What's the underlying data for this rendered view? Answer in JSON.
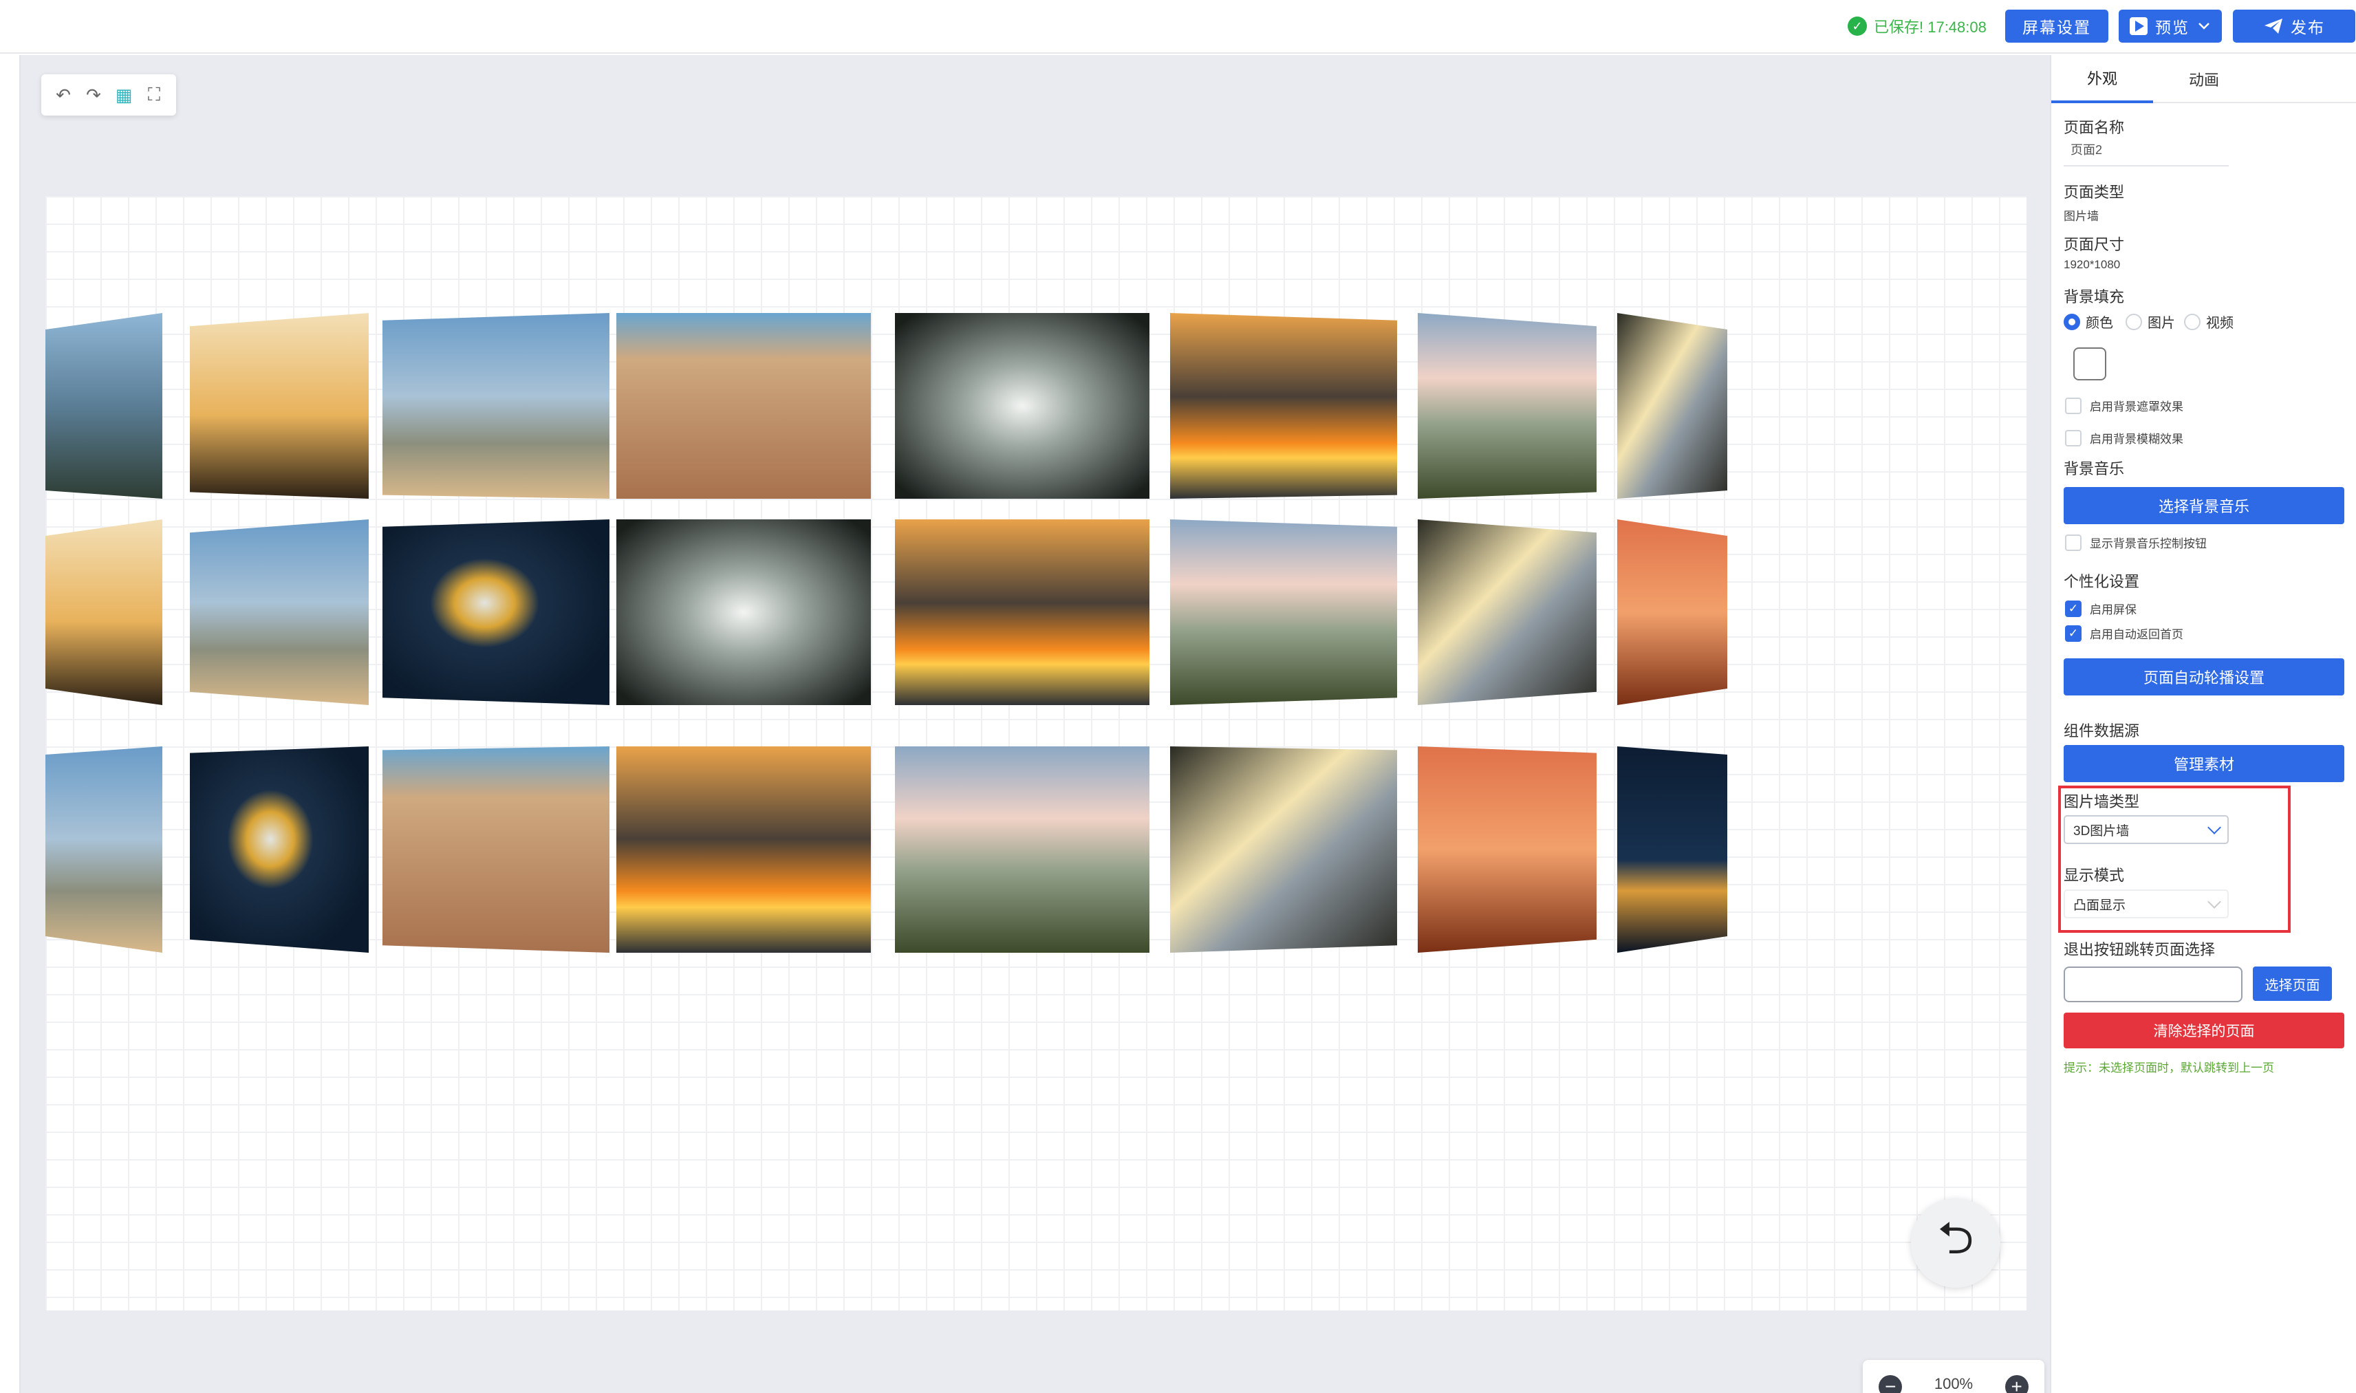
{
  "header": {
    "save_status": "已保存! 17:48:08",
    "screen_settings_label": "屏幕设置",
    "preview_label": "预览",
    "publish_label": "发布"
  },
  "toolbar": {
    "icons": [
      "undo-icon",
      "redo-icon",
      "grid-icon",
      "fit-screen-icon"
    ],
    "undo_glyph": "↶",
    "redo_glyph": "↷",
    "grid_glyph": "▦",
    "fit_glyph": "⛶"
  },
  "canvas": {
    "gallery_type": "3D图片墙",
    "rows": [
      [
        "window-mountain",
        "golden-haze",
        "hot-air-balloons",
        "desert-dunes",
        "forest-canopy",
        "ocean-sunset",
        "cloudy-hills",
        "lake-valley"
      ],
      [
        "golden-haze",
        "hot-air-balloons",
        "jellyfish",
        "forest-canopy",
        "ocean-sunset",
        "cloudy-hills",
        "lake-valley",
        "sunset-grass"
      ],
      [
        "hot-air-balloons",
        "jellyfish",
        "desert-dunes",
        "ocean-sunset",
        "cloudy-hills",
        "lake-valley",
        "sunset-grass",
        "city-night"
      ]
    ],
    "back_glyph": "⮌"
  },
  "zoom": {
    "minus": "−",
    "level": "100%",
    "plus": "+"
  },
  "panel": {
    "tabs": [
      "外观",
      "动画"
    ],
    "page_name_label": "页面名称",
    "page_name_value": "页面2",
    "page_type_label": "页面类型",
    "page_type_value": "图片墙",
    "page_size_label": "页面尺寸",
    "page_size_value": "1920*1080",
    "bg_fill_label": "背景填充",
    "bg_fill_options": [
      "颜色",
      "图片",
      "视频"
    ],
    "bg_fill_selected": "颜色",
    "bg_mask_label": "启用背景遮罩效果",
    "bg_blur_label": "启用背景模糊效果",
    "bg_music_label": "背景音乐",
    "choose_music_button": "选择背景音乐",
    "show_music_btn_label": "显示背景音乐控制按钮",
    "personal_label": "个性化设置",
    "screensaver_label": "启用屏保",
    "auto_home_label": "启用自动返回首页",
    "carousel_button": "页面自动轮播设置",
    "data_source_label": "组件数据源",
    "manage_assets_button": "管理素材",
    "wall_type_label": "图片墙类型",
    "wall_type_value": "3D图片墙",
    "display_mode_label": "显示模式",
    "display_mode_value": "凸面显示",
    "exit_jump_label": "退出按钮跳转页面选择",
    "choose_page_button": "选择页面",
    "clear_page_button": "清除选择的页面",
    "tip": "提示：未选择页面时，默认跳转到上一页"
  },
  "colors": {
    "primary": "#2f6ae6",
    "danger": "#e5343d",
    "success": "#27b34a",
    "canvas_bg": "#e9ebf1"
  }
}
